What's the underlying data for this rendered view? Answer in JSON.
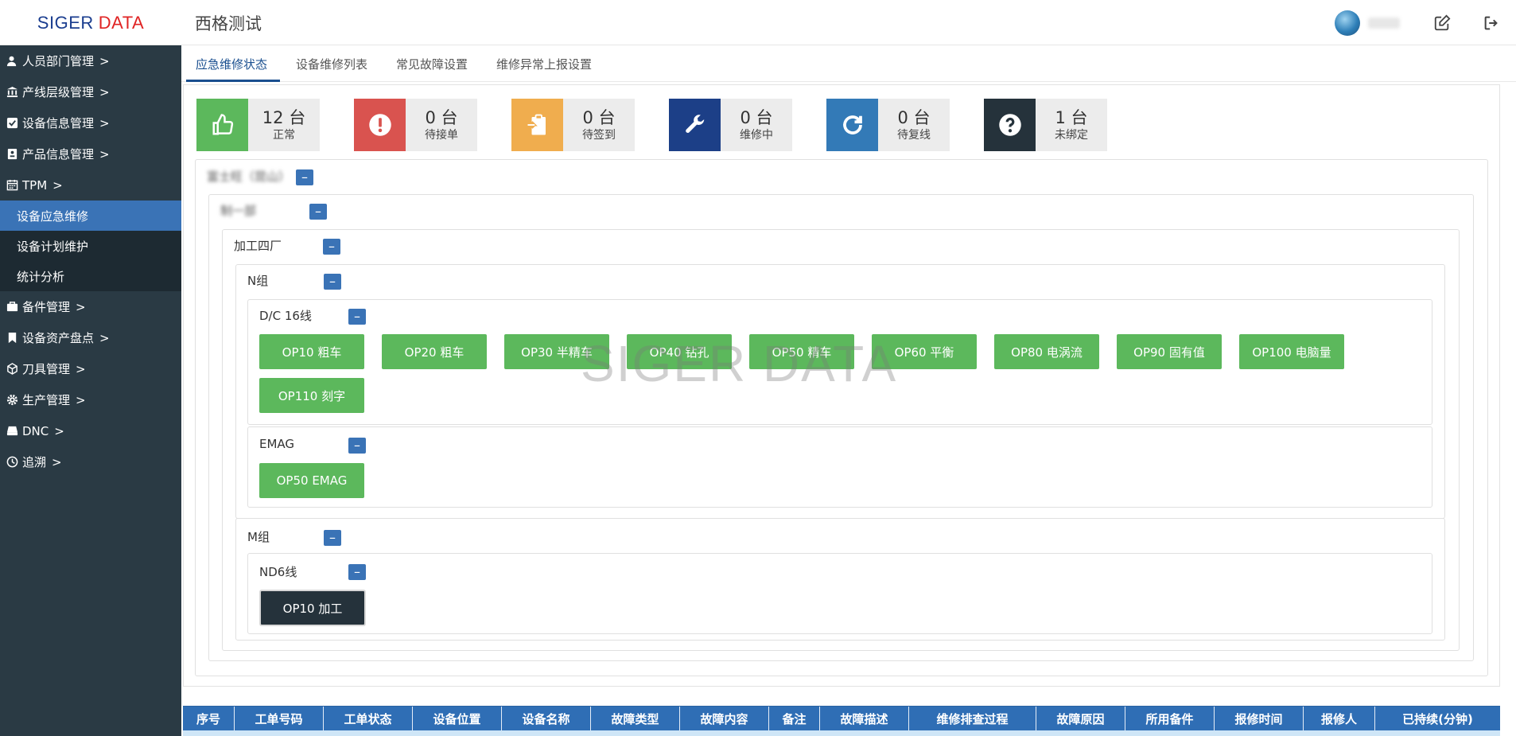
{
  "header": {
    "logo_part1": "SIGER",
    "logo_part2": "DATA",
    "title": "西格测试"
  },
  "sidebar": {
    "items": [
      {
        "label": "人员部门管理",
        "icon": "user-icon"
      },
      {
        "label": "产线层级管理",
        "icon": "bank-icon"
      },
      {
        "label": "设备信息管理",
        "icon": "check-square-icon"
      },
      {
        "label": "产品信息管理",
        "icon": "id-card-icon"
      },
      {
        "label": "TPM",
        "icon": "calendar-icon"
      }
    ],
    "tpm_sub": [
      {
        "label": "设备应急维修",
        "active": true
      },
      {
        "label": "设备计划维护"
      },
      {
        "label": "统计分析"
      }
    ],
    "items_after": [
      {
        "label": "备件管理",
        "icon": "briefcase-icon"
      },
      {
        "label": "设备资产盘点",
        "icon": "bookmark-icon"
      },
      {
        "label": "刀具管理",
        "icon": "cube-icon"
      },
      {
        "label": "生产管理",
        "icon": "gear-icon"
      },
      {
        "label": "DNC",
        "icon": "hdd-icon"
      },
      {
        "label": "追溯",
        "icon": "clock-icon"
      }
    ],
    "chevron": ">"
  },
  "tabs": [
    {
      "label": "应急维修状态",
      "active": true
    },
    {
      "label": "设备维修列表"
    },
    {
      "label": "常见故障设置"
    },
    {
      "label": "维修异常上报设置"
    }
  ],
  "stats": [
    {
      "count": "12 台",
      "label": "正常",
      "color": "#5cb85c",
      "icon": "thumbs-up-icon"
    },
    {
      "count": "0 台",
      "label": "待接单",
      "color": "#d9534f",
      "icon": "exclamation-circle-icon"
    },
    {
      "count": "0 台",
      "label": "待签到",
      "color": "#f0ad4e",
      "icon": "clipboard-sign-in-icon"
    },
    {
      "count": "0 台",
      "label": "维修中",
      "color": "#1c3f87",
      "icon": "wrench-icon"
    },
    {
      "count": "0 台",
      "label": "待复线",
      "color": "#337ab7",
      "icon": "refresh-icon"
    },
    {
      "count": "1 台",
      "label": "未绑定",
      "color": "#25323b",
      "icon": "question-circle-icon"
    }
  ],
  "tree": {
    "level1": "富士旺（昆山）",
    "level2": "制一部",
    "level3": "加工四厂",
    "collapse_symbol": "–",
    "groups": [
      {
        "name": "N组",
        "lines": [
          {
            "name": "D/C 16线",
            "equipment": [
              "OP10 粗车",
              "OP20 粗车",
              "OP30 半精车",
              "OP40 钻孔",
              "OP50 精车",
              "OP60 平衡",
              "OP80 电涡流",
              "OP90 固有值",
              "OP100 电脑量",
              "OP110 刻字"
            ]
          },
          {
            "name": "EMAG",
            "equipment": [
              "OP50 EMAG"
            ]
          }
        ]
      },
      {
        "name": "M组",
        "lines": [
          {
            "name": "ND6线",
            "equipment": [
              "OP10 加工"
            ]
          }
        ]
      }
    ]
  },
  "watermark": "SIGER DATA",
  "table": {
    "headers": [
      "序号",
      "工单号码",
      "工单状态",
      "设备位置",
      "设备名称",
      "故障类型",
      "故障内容",
      "备注",
      "故障描述",
      "维修排查过程",
      "故障原因",
      "所用备件",
      "报修时间",
      "报修人",
      "已持续(分钟)"
    ]
  }
}
